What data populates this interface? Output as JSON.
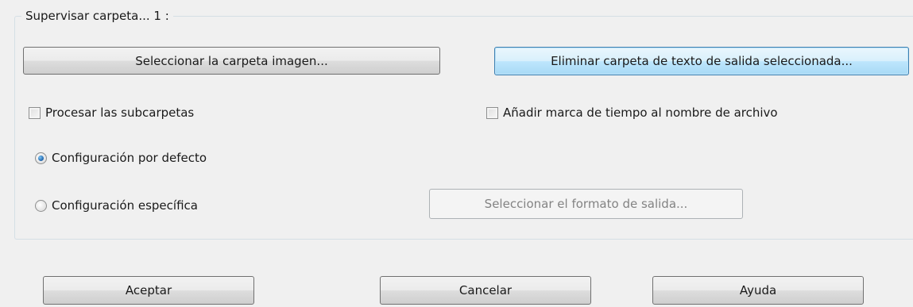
{
  "group": {
    "legend": "Supervisar carpeta... 1 :"
  },
  "buttons": {
    "select_image_folder": "Seleccionar la carpeta imagen...",
    "remove_output_folder": "Eliminar carpeta de texto de salida seleccionada...",
    "select_output_format": "Seleccionar el formato de salida..."
  },
  "checkboxes": {
    "process_subfolders": {
      "label": "Procesar las subcarpetas",
      "checked": false
    },
    "add_timestamp": {
      "label": "Añadir marca de tiempo al nombre de archivo",
      "checked": false
    }
  },
  "radios": {
    "default_config": {
      "label": "Configuración por defecto",
      "checked": true
    },
    "specific_config": {
      "label": "Configuración específica",
      "checked": false
    }
  },
  "footer": {
    "ok_label": "Aceptar",
    "cancel_label": "Cancelar",
    "help_label": "Ayuda"
  }
}
